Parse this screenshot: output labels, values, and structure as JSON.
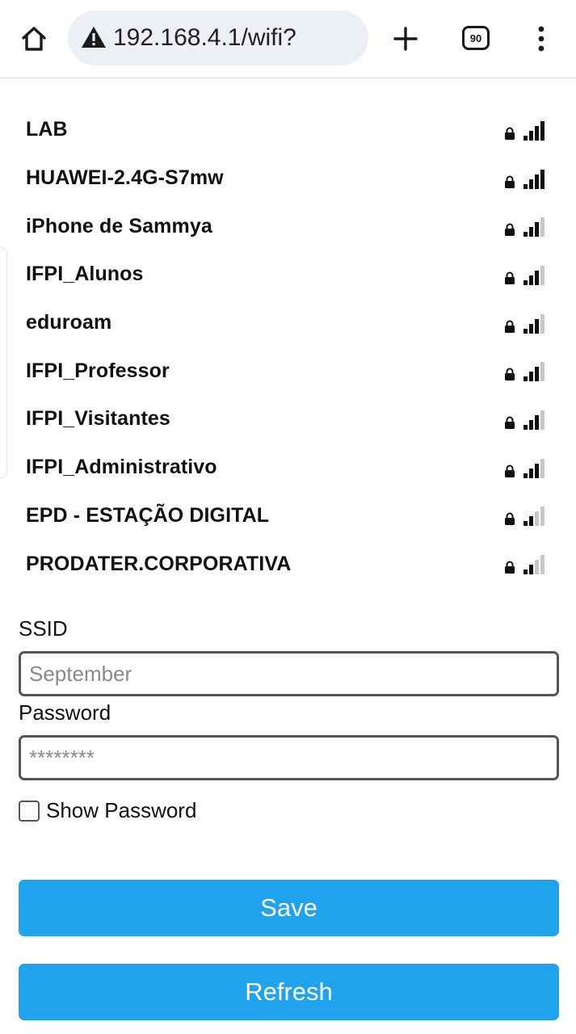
{
  "browser": {
    "url": "192.168.4.1/wifi?",
    "tab_count": "90"
  },
  "networks": [
    {
      "ssid": "LAB",
      "secured": true,
      "signal_bars": 4
    },
    {
      "ssid": "HUAWEI-2.4G-S7mw",
      "secured": true,
      "signal_bars": 4
    },
    {
      "ssid": "iPhone de Sammya",
      "secured": true,
      "signal_bars": 3
    },
    {
      "ssid": "IFPI_Alunos",
      "secured": true,
      "signal_bars": 3
    },
    {
      "ssid": "eduroam",
      "secured": true,
      "signal_bars": 3
    },
    {
      "ssid": "IFPI_Professor",
      "secured": true,
      "signal_bars": 3
    },
    {
      "ssid": "IFPI_Visitantes",
      "secured": true,
      "signal_bars": 3
    },
    {
      "ssid": "IFPI_Administrativo",
      "secured": true,
      "signal_bars": 3
    },
    {
      "ssid": "EPD - ESTAÇÃO DIGITAL",
      "secured": true,
      "signal_bars": 2
    },
    {
      "ssid": "PRODATER.CORPORATIVA",
      "secured": true,
      "signal_bars": 2
    }
  ],
  "form": {
    "ssid_label": "SSID",
    "ssid_placeholder": "September",
    "password_label": "Password",
    "password_placeholder": "********",
    "show_password_label": "Show Password",
    "save_label": "Save",
    "refresh_label": "Refresh"
  },
  "colors": {
    "button": "#1fa3ec",
    "signal_active": "#111111",
    "signal_inactive": "#c8c8c8"
  }
}
